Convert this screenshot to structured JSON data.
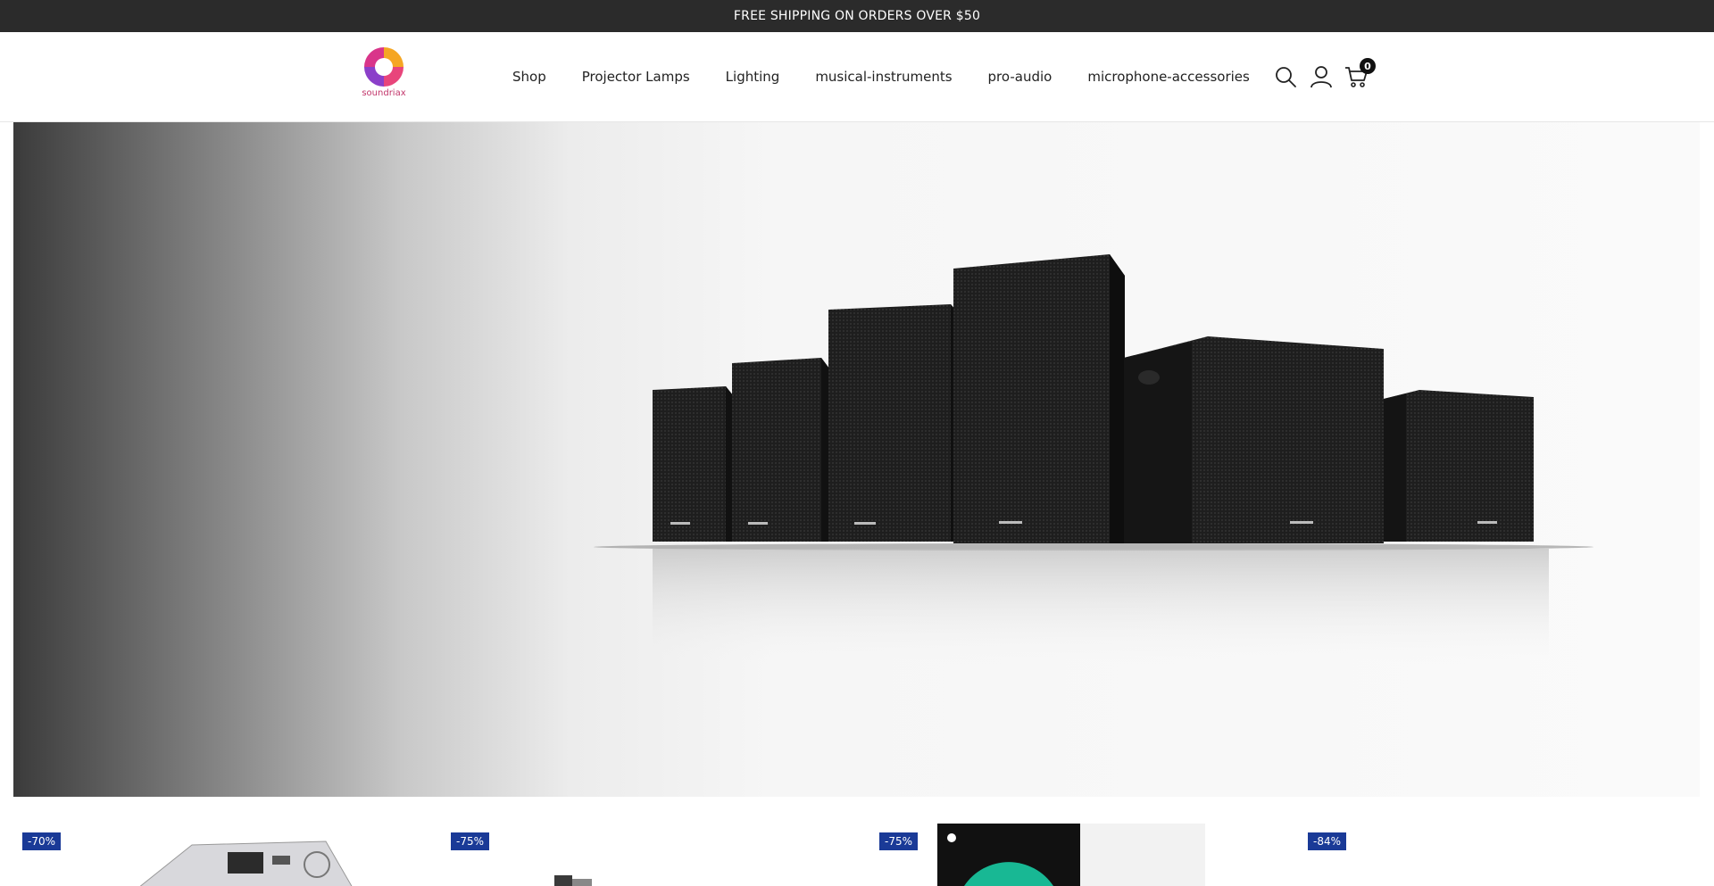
{
  "announcement": {
    "text": "FREE SHIPPING ON ORDERS OVER $50"
  },
  "brand": {
    "logo_text": "soundriax"
  },
  "nav": {
    "items": [
      {
        "label": "Shop"
      },
      {
        "label": "Projector Lamps"
      },
      {
        "label": "Lighting"
      },
      {
        "label": "musical-instruments"
      },
      {
        "label": "pro-audio"
      },
      {
        "label": "microphone-accessories"
      }
    ]
  },
  "cart": {
    "count": "0"
  },
  "hero": {
    "image": "speaker-lineup-banner"
  },
  "products": [
    {
      "discount": "-70%"
    },
    {
      "discount": "-75%"
    },
    {
      "discount": "-75%"
    },
    {
      "discount": "-84%"
    }
  ],
  "colors": {
    "topbar": "#2b2b2b",
    "badge": "#1a3a97",
    "logo_accent": "#c2366b"
  }
}
